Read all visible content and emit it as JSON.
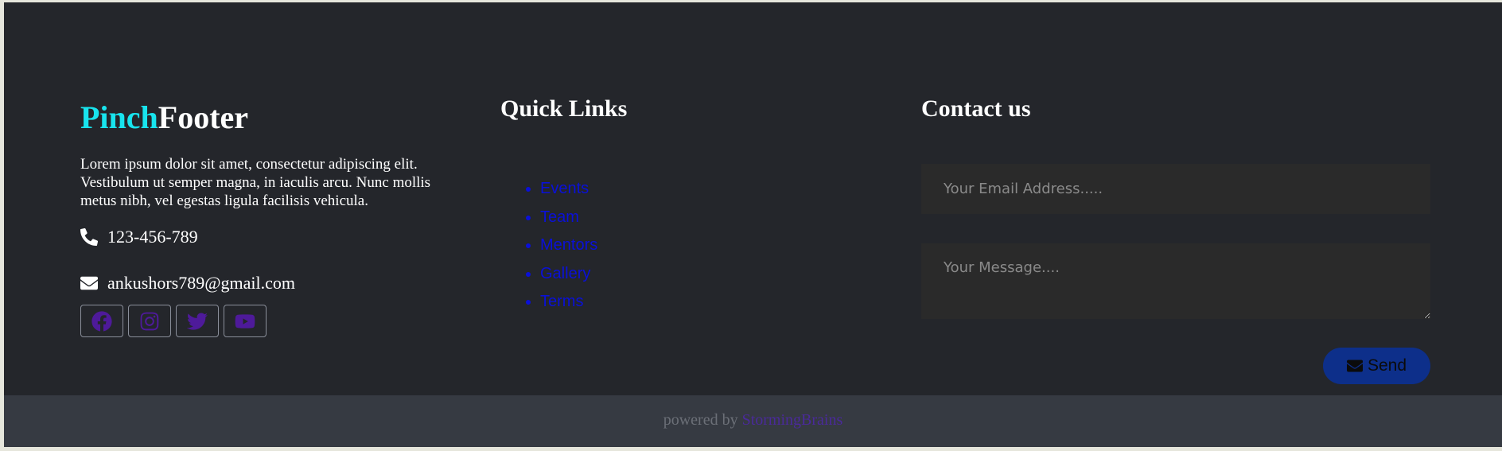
{
  "brand": {
    "part1": "Pinch",
    "part2": "Footer"
  },
  "about": {
    "text": "Lorem ipsum dolor sit amet, consectetur adipiscing elit. Vestibulum ut semper magna, in iaculis arcu. Nunc mollis metus nibh, vel egestas ligula facilisis vehicula."
  },
  "contact": {
    "phone": "123-456-789",
    "email": "ankushors789@gmail.com",
    "phone_icon": "phone-icon",
    "email_icon": "envelope-icon"
  },
  "socials": [
    {
      "icon": "facebook-icon"
    },
    {
      "icon": "instagram-icon"
    },
    {
      "icon": "twitter-icon"
    },
    {
      "icon": "youtube-icon"
    }
  ],
  "quick_links": {
    "heading": "Quick Links",
    "items": [
      {
        "label": "Events"
      },
      {
        "label": "Team"
      },
      {
        "label": "Mentors"
      },
      {
        "label": "Gallery"
      },
      {
        "label": "Terms"
      }
    ]
  },
  "contact_form": {
    "heading": "Contact us",
    "email_placeholder": "Your Email Address.....",
    "message_placeholder": "Your Message....",
    "send_label": "Send",
    "send_icon": "envelope-icon"
  },
  "bottom": {
    "prefix": "powered by",
    "brand": "StormingBrains"
  },
  "colors": {
    "background": "#24262b",
    "bottom_bar": "#363a42",
    "accent": "#18e4ee",
    "link": "#0a10d8",
    "social_icon": "#4e1a9a",
    "send_button": "#0d2f8a"
  }
}
